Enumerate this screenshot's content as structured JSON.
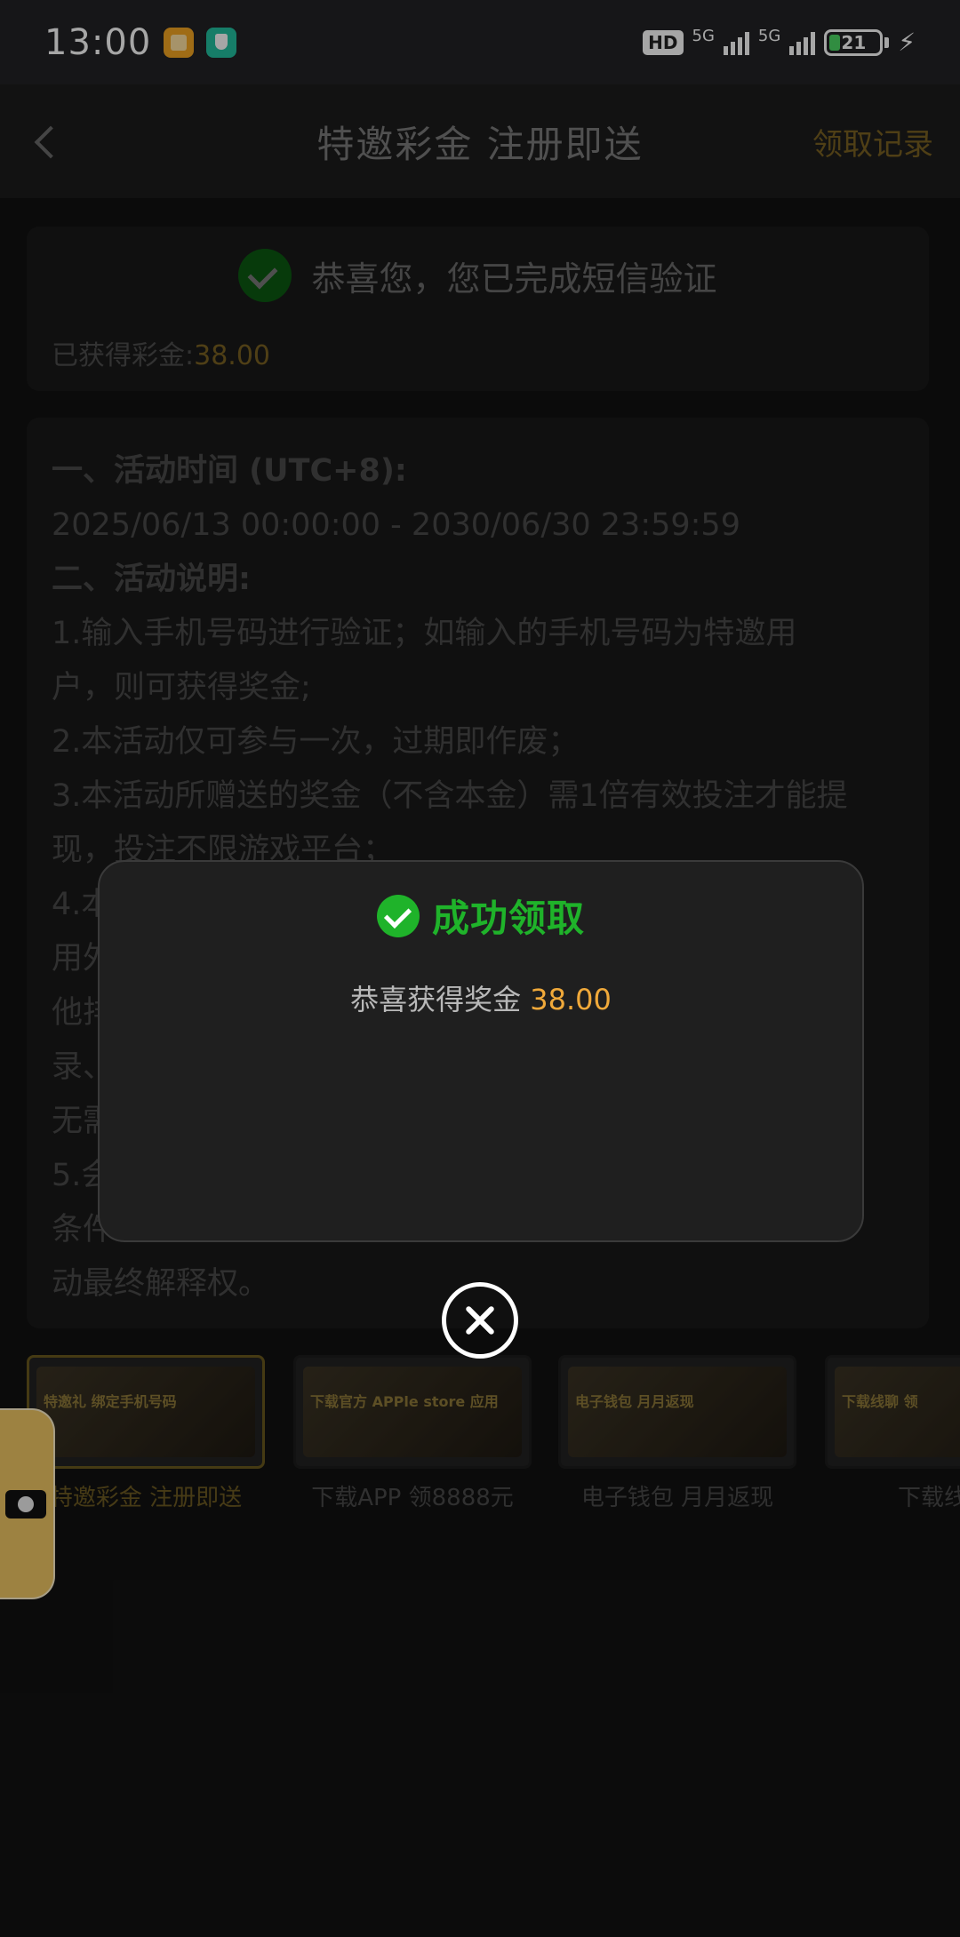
{
  "status_bar": {
    "time": "13:00",
    "hd": "HD",
    "net1": "5G",
    "net2": "5G",
    "battery": "21",
    "icons": [
      "gallery-icon",
      "shield-icon",
      "signal-icon",
      "battery-icon",
      "charging-icon"
    ]
  },
  "header": {
    "title": "特邀彩金 注册即送",
    "record": "领取记录"
  },
  "verify_card": {
    "message": "恭喜您，您已完成短信验证",
    "earned_label": "已获得彩金:",
    "earned_value": "38.00"
  },
  "rules": {
    "lines": [
      "一、活动时间 (UTC+8):",
      "2025/06/13 00:00:00 - 2030/06/30 23:59:59",
      "二、活动说明:",
      "1.输入手机号码进行验证；如输入的手机号码为特邀用",
      "户，则可获得奖金;",
      "2.本活动仅可参与一次，过期即作废；",
      "3.本活动所赠送的奖金（不含本金）需1倍有效投注才能提",
      "现，投注不限游戏平台；",
      "4.本",
      "用外",
      "他排",
      "录、",
      "无需",
      "5.会",
      "条件",
      "动最终解释权。"
    ]
  },
  "tabs": [
    {
      "label": "特邀彩金 注册即送",
      "banner": "特邀礼 绑定手机号码"
    },
    {
      "label": "下载APP 领8888元",
      "banner": "下载官方 APPle store 应用"
    },
    {
      "label": "电子钱包 月月返现",
      "banner": "电子钱包 月月返现"
    },
    {
      "label": "下载线聊",
      "banner": "下载线聊 领"
    }
  ],
  "modal": {
    "title": "成功领取",
    "message": "恭喜获得奖金",
    "amount": "38.00"
  },
  "colors": {
    "accent_gold": "#f0a93a",
    "success_green": "#1fb32a"
  }
}
